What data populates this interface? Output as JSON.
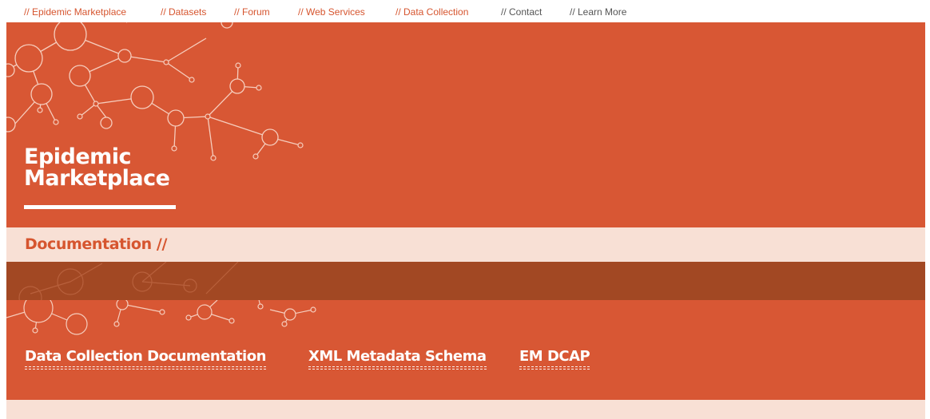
{
  "topnav": {
    "items": [
      {
        "label": "// Epidemic Marketplace"
      },
      {
        "label": "// Datasets"
      },
      {
        "label": "// Forum"
      },
      {
        "label": "// Web Services"
      },
      {
        "label": "// Data Collection"
      },
      {
        "label": "// Contact"
      },
      {
        "label": "// Learn More"
      }
    ]
  },
  "hero": {
    "brand_line1": "Epidemic",
    "brand_line2": "Marketplace"
  },
  "section": {
    "title": "Documentation //"
  },
  "doc_links": [
    {
      "label": "Data Collection Documentation"
    },
    {
      "label": "XML Metadata Schema"
    },
    {
      "label": "EM DCAP"
    }
  ],
  "colors": {
    "accent": "#d85734",
    "dark_band": "#a24823",
    "light_band": "#f8e0d5",
    "nav_link": "#d6552f",
    "nav_link_muted": "#555555"
  }
}
